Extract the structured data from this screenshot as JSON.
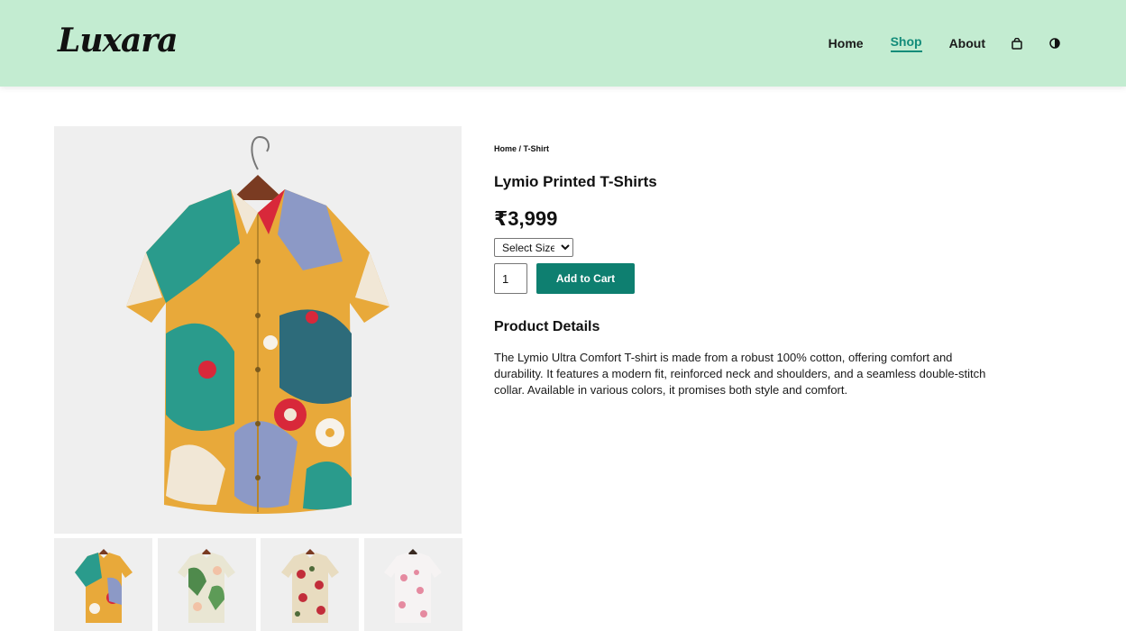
{
  "header": {
    "logo": "Luxara",
    "nav": [
      {
        "label": "Home",
        "active": false
      },
      {
        "label": "Shop",
        "active": true
      },
      {
        "label": "About",
        "active": false
      }
    ],
    "icons": [
      "shopping-bag-icon",
      "theme-toggle-icon"
    ]
  },
  "product": {
    "breadcrumb": "Home / T-Shirt",
    "title": "Lymio Printed T-Shirts",
    "price": "₹3,999",
    "size_select": {
      "selected": "Select Size"
    },
    "quantity": "1",
    "add_to_cart_label": "Add to Cart",
    "details_heading": "Product Details",
    "details_text": "The Lymio Ultra Comfort T-shirt is made from a robust 100% cotton, offering comfort and durability. It features a modern fit, reinforced neck and shoulders, and a seamless double-stitch collar. Available in various colors, it promises both style and comfort."
  },
  "colors": {
    "header_bg": "#c3ecd1",
    "accent": "#138c7a",
    "button_bg": "#0e7f70"
  }
}
